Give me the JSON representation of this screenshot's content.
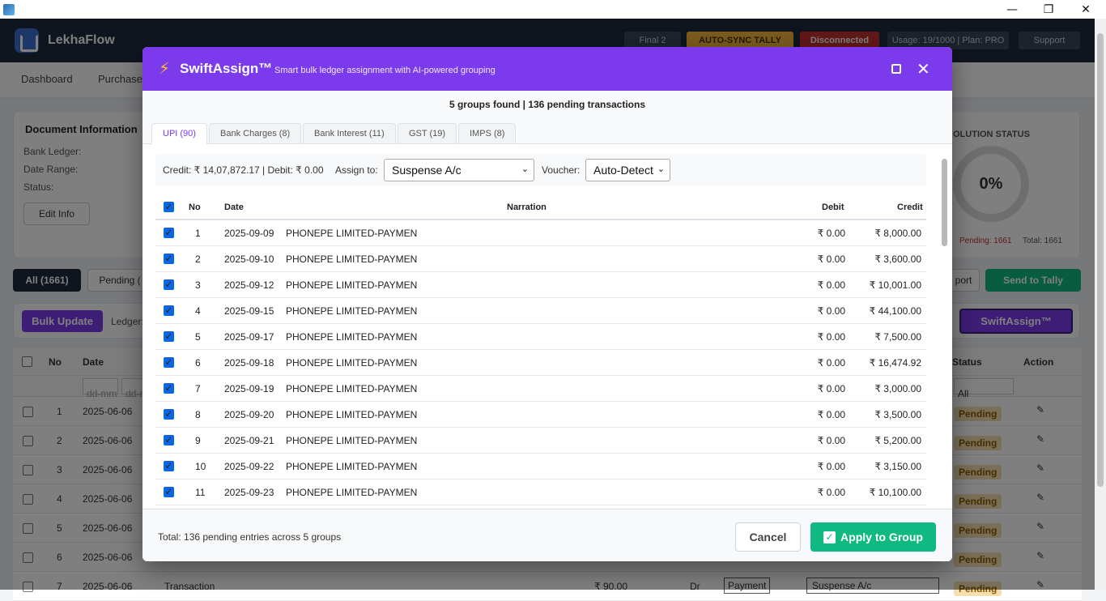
{
  "window": {
    "minimize_icon": "—",
    "restore_icon": "❐",
    "close_icon": "✕"
  },
  "header": {
    "brand": "LekhaFlow",
    "badges": {
      "final": "Final 2",
      "autosync": "AUTO-SYNC TALLY",
      "status": "Disconnected",
      "usage": "Usage: 19/1000 | Plan: PRO",
      "support": "Support"
    }
  },
  "nav": {
    "items": [
      "Dashboard",
      "Purchase"
    ]
  },
  "background": {
    "doc_title": "Document Information",
    "bank_ledger_label": "Bank Ledger:",
    "date_range_label": "Date Range:",
    "status_label": "Status:",
    "edit_info": "Edit Info",
    "resolution_title": "OLUTION STATUS",
    "resolution_percent": "0%",
    "pending_count": "Pending: 1661",
    "total_count": "Total: 1661",
    "filter_all": "All (1661)",
    "filter_pending": "Pending (",
    "export_label": "port",
    "send_to_tally": "Send to Tally",
    "bulk_update": "Bulk Update",
    "ledger_label": "Ledger:",
    "swiftassign_button": "SwiftAssign™",
    "columns": {
      "no": "No",
      "date": "Date",
      "status": "Status",
      "action": "Action"
    },
    "date_filter_placeholder": "dd-mm",
    "status_filter": "All",
    "rows": [
      {
        "no": "1",
        "date": "2025-06-06",
        "status": "Pending"
      },
      {
        "no": "2",
        "date": "2025-06-06",
        "status": "Pending"
      },
      {
        "no": "3",
        "date": "2025-06-06",
        "status": "Pending"
      },
      {
        "no": "4",
        "date": "2025-06-06",
        "status": "Pending"
      },
      {
        "no": "5",
        "date": "2025-06-06",
        "status": "Pending"
      },
      {
        "no": "6",
        "date": "2025-06-06",
        "status": "Pending"
      },
      {
        "no": "7",
        "date": "2025-06-06",
        "status": "Pending"
      }
    ],
    "row7": {
      "narration": "Transaction",
      "amount": "₹ 90.00",
      "drcr": "Dr",
      "voucher": "Payment",
      "ledger": "Suspense A/c"
    }
  },
  "modal": {
    "title": "SwiftAssign™",
    "subtitle": "Smart bulk ledger assignment with AI-powered grouping",
    "summary": "5 groups found | 136 pending transactions",
    "tabs": [
      "UPI (90)",
      "Bank Charges (8)",
      "Bank Interest (11)",
      "GST (19)",
      "IMPS (8)"
    ],
    "totals": "Credit: ₹ 14,07,872.17 | Debit: ₹ 0.00",
    "assign_label": "Assign to:",
    "assign_value": "Suspense A/c",
    "voucher_label": "Voucher:",
    "voucher_value": "Auto-Detect",
    "columns": {
      "no": "No",
      "date": "Date",
      "narration": "Narration",
      "debit": "Debit",
      "credit": "Credit"
    },
    "rows": [
      {
        "no": "1",
        "date": "2025-09-09",
        "narration": "PHONEPE LIMITED-PAYMEN",
        "debit": "₹ 0.00",
        "credit": "₹ 8,000.00"
      },
      {
        "no": "2",
        "date": "2025-09-10",
        "narration": "PHONEPE LIMITED-PAYMEN",
        "debit": "₹ 0.00",
        "credit": "₹ 3,600.00"
      },
      {
        "no": "3",
        "date": "2025-09-12",
        "narration": "PHONEPE LIMITED-PAYMEN",
        "debit": "₹ 0.00",
        "credit": "₹ 10,001.00"
      },
      {
        "no": "4",
        "date": "2025-09-15",
        "narration": "PHONEPE LIMITED-PAYMEN",
        "debit": "₹ 0.00",
        "credit": "₹ 44,100.00"
      },
      {
        "no": "5",
        "date": "2025-09-17",
        "narration": "PHONEPE LIMITED-PAYMEN",
        "debit": "₹ 0.00",
        "credit": "₹ 7,500.00"
      },
      {
        "no": "6",
        "date": "2025-09-18",
        "narration": "PHONEPE LIMITED-PAYMEN",
        "debit": "₹ 0.00",
        "credit": "₹ 16,474.92"
      },
      {
        "no": "7",
        "date": "2025-09-19",
        "narration": "PHONEPE LIMITED-PAYMEN",
        "debit": "₹ 0.00",
        "credit": "₹ 3,000.00"
      },
      {
        "no": "8",
        "date": "2025-09-20",
        "narration": "PHONEPE LIMITED-PAYMEN",
        "debit": "₹ 0.00",
        "credit": "₹ 3,500.00"
      },
      {
        "no": "9",
        "date": "2025-09-21",
        "narration": "PHONEPE LIMITED-PAYMEN",
        "debit": "₹ 0.00",
        "credit": "₹ 5,200.00"
      },
      {
        "no": "10",
        "date": "2025-09-22",
        "narration": "PHONEPE LIMITED-PAYMEN",
        "debit": "₹ 0.00",
        "credit": "₹ 3,150.00"
      },
      {
        "no": "11",
        "date": "2025-09-23",
        "narration": "PHONEPE LIMITED-PAYMEN",
        "debit": "₹ 0.00",
        "credit": "₹ 10,100.00"
      }
    ],
    "footer_total": "Total: 136 pending entries across 5 groups",
    "cancel": "Cancel",
    "apply": "Apply to Group"
  },
  "colors": {
    "modal_header": "#7c3aed",
    "apply": "#10b981",
    "app_header": "#1e2a3f"
  }
}
